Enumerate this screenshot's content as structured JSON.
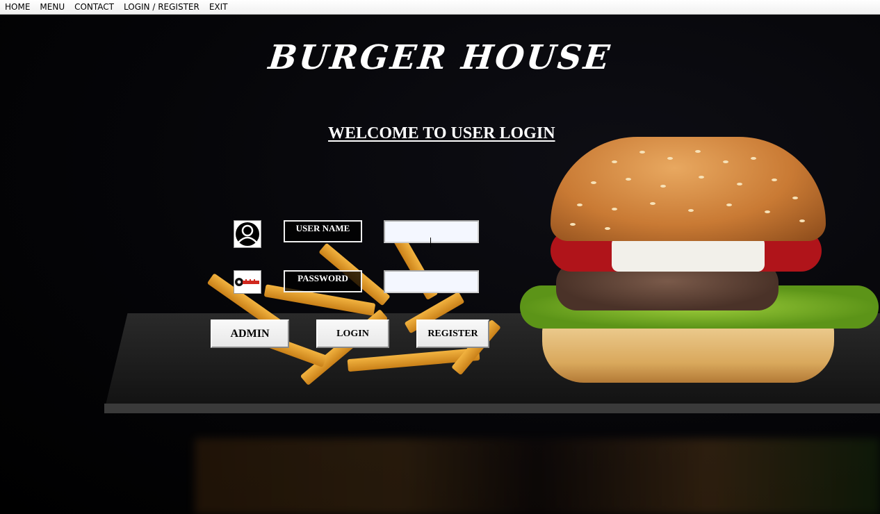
{
  "menubar": {
    "items": [
      {
        "label": "HOME"
      },
      {
        "label": "MENU"
      },
      {
        "label": "CONTACT"
      },
      {
        "label": "LOGIN / REGISTER"
      },
      {
        "label": "EXIT"
      }
    ]
  },
  "header": {
    "title": "BURGER HOUSE",
    "subtitle": "WELCOME TO USER LOGIN"
  },
  "login_form": {
    "username": {
      "label": "USER NAME",
      "value": "",
      "icon": "user-silhouette-icon"
    },
    "password": {
      "label": "PASSWORD",
      "value": "",
      "icon": "key-icon"
    },
    "buttons": {
      "admin": "ADMIN",
      "login": "LOGIN",
      "register": "REGISTER"
    }
  },
  "colors": {
    "background": "#000000",
    "text": "#ffffff",
    "menubar": "#f0f0f0",
    "input_bg": "#f4f7ff",
    "key_accent": "#d0281e"
  }
}
